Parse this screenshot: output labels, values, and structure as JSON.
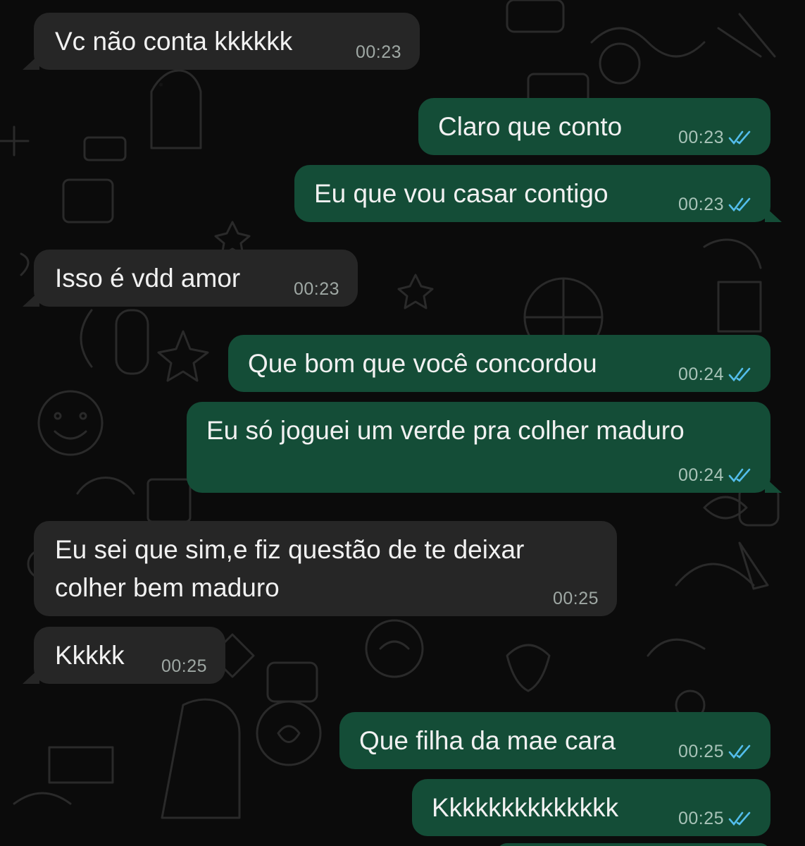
{
  "messages": [
    {
      "dir": "in",
      "text": "Vc não conta kkkkkk",
      "time": "00:23",
      "ticks": false
    },
    {
      "dir": "out",
      "text": "Claro que conto",
      "time": "00:23",
      "ticks": true
    },
    {
      "dir": "out",
      "text": "Eu que vou casar contigo",
      "time": "00:23",
      "ticks": true
    },
    {
      "dir": "in",
      "text": "Isso é vdd amor",
      "time": "00:23",
      "ticks": false
    },
    {
      "dir": "out",
      "text": "Que bom que você concordou",
      "time": "00:24",
      "ticks": true
    },
    {
      "dir": "out",
      "text": "Eu só joguei um verde pra colher maduro",
      "time": "00:24",
      "ticks": true
    },
    {
      "dir": "in",
      "text": "Eu sei que sim,e fiz questão de te deixar",
      "text2": "colher bem maduro",
      "time": "00:25",
      "ticks": false
    },
    {
      "dir": "in",
      "text": "Kkkkk",
      "time": "00:25",
      "ticks": false
    },
    {
      "dir": "out",
      "text": "Que filha da mae cara",
      "time": "00:25",
      "ticks": true
    },
    {
      "dir": "out",
      "text": "Kkkkkkkkkkkkkk",
      "time": "00:25",
      "ticks": true
    }
  ],
  "colors": {
    "background": "#0b0b0b",
    "incoming_bubble": "#262626",
    "outgoing_bubble": "#144d37",
    "read_ticks": "#53bdeb"
  }
}
